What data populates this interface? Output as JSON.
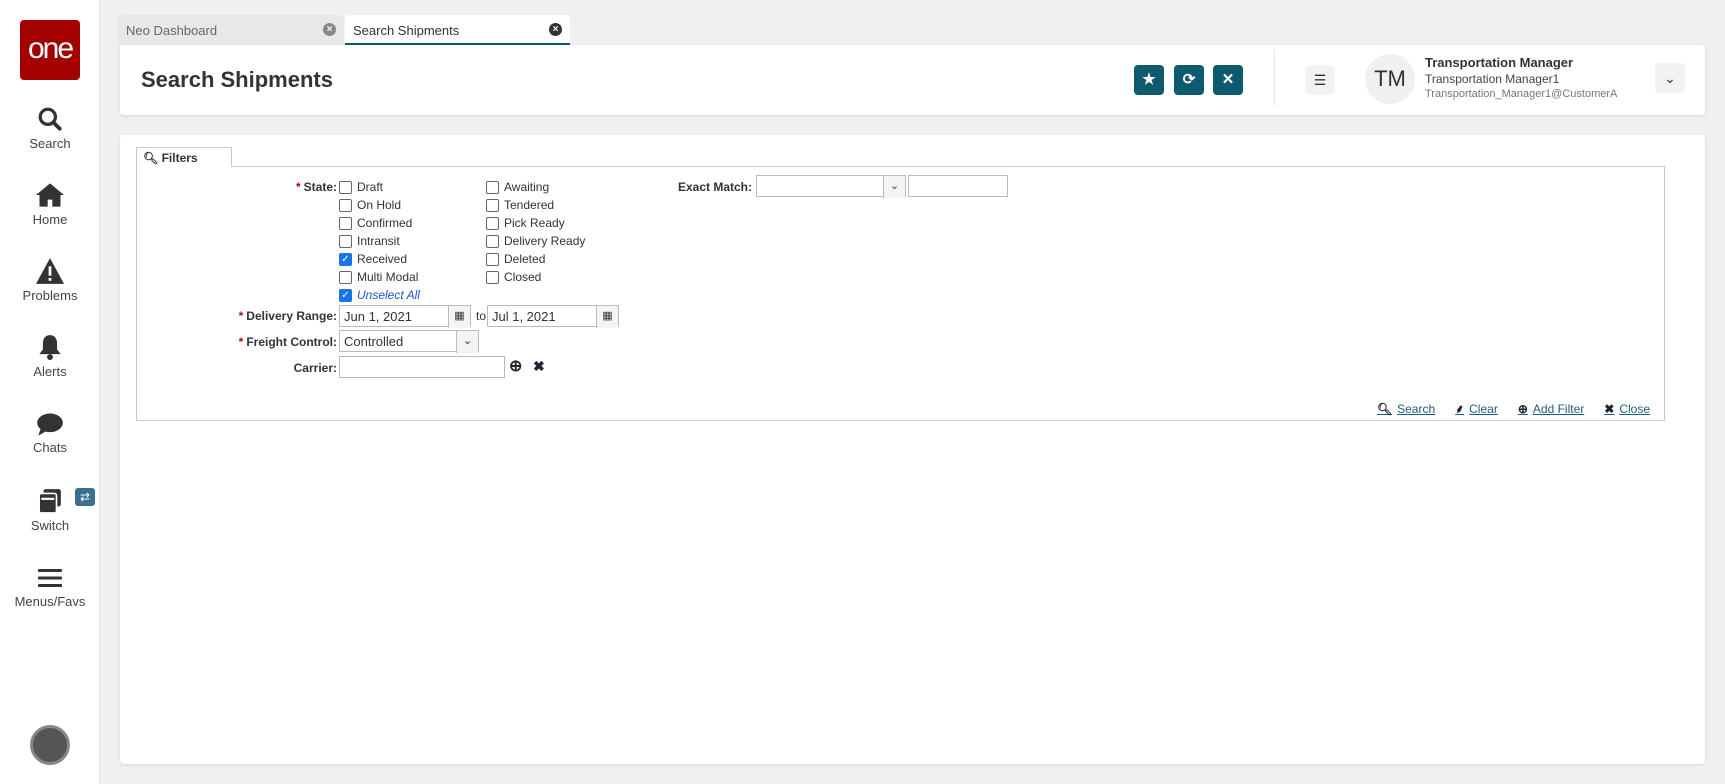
{
  "sidebar": {
    "logo": "one",
    "items": [
      {
        "label": "Search",
        "icon": "search-icon"
      },
      {
        "label": "Home",
        "icon": "home-icon"
      },
      {
        "label": "Problems",
        "icon": "warning-icon"
      },
      {
        "label": "Alerts",
        "icon": "bell-icon"
      },
      {
        "label": "Chats",
        "icon": "chat-icon"
      },
      {
        "label": "Switch",
        "icon": "switch-icon"
      },
      {
        "label": "Menus/Favs",
        "icon": "menu-icon"
      }
    ],
    "switch_badge": "⇄"
  },
  "tabs": [
    {
      "label": "Neo Dashboard",
      "active": false
    },
    {
      "label": "Search Shipments",
      "active": true
    }
  ],
  "header": {
    "title": "Search Shipments",
    "user_initials": "TM",
    "user_role": "Transportation Manager",
    "user_name": "Transportation Manager1",
    "user_id": "Transportation_Manager1@CustomerA"
  },
  "colors": {
    "accent": "#0e5a6e",
    "logo": "#a30000",
    "checkbox": "#1a73e8"
  },
  "filters": {
    "tab_label": "Filters",
    "state_label": "State:",
    "states_col1": [
      {
        "label": "Draft",
        "checked": false
      },
      {
        "label": "On Hold",
        "checked": false
      },
      {
        "label": "Confirmed",
        "checked": false
      },
      {
        "label": "Intransit",
        "checked": false
      },
      {
        "label": "Received",
        "checked": true
      },
      {
        "label": "Multi Modal",
        "checked": false
      }
    ],
    "states_col2": [
      {
        "label": "Awaiting",
        "checked": false
      },
      {
        "label": "Tendered",
        "checked": false
      },
      {
        "label": "Pick Ready",
        "checked": false
      },
      {
        "label": "Delivery Ready",
        "checked": false
      },
      {
        "label": "Deleted",
        "checked": false
      },
      {
        "label": "Closed",
        "checked": false
      }
    ],
    "unselect_all": "Unselect All",
    "exact_match_label": "Exact Match:",
    "exact_match_value": "",
    "exact_match_text": "",
    "delivery_range_label": "Delivery Range:",
    "delivery_from": "Jun 1, 2021",
    "to_label": "to",
    "delivery_to": "Jul 1, 2021",
    "freight_control_label": "Freight Control:",
    "freight_control_value": "Controlled",
    "carrier_label": "Carrier:",
    "carrier_value": "",
    "actions": {
      "search": "Search",
      "clear": "Clear",
      "add_filter": "Add Filter",
      "close": "Close"
    }
  }
}
